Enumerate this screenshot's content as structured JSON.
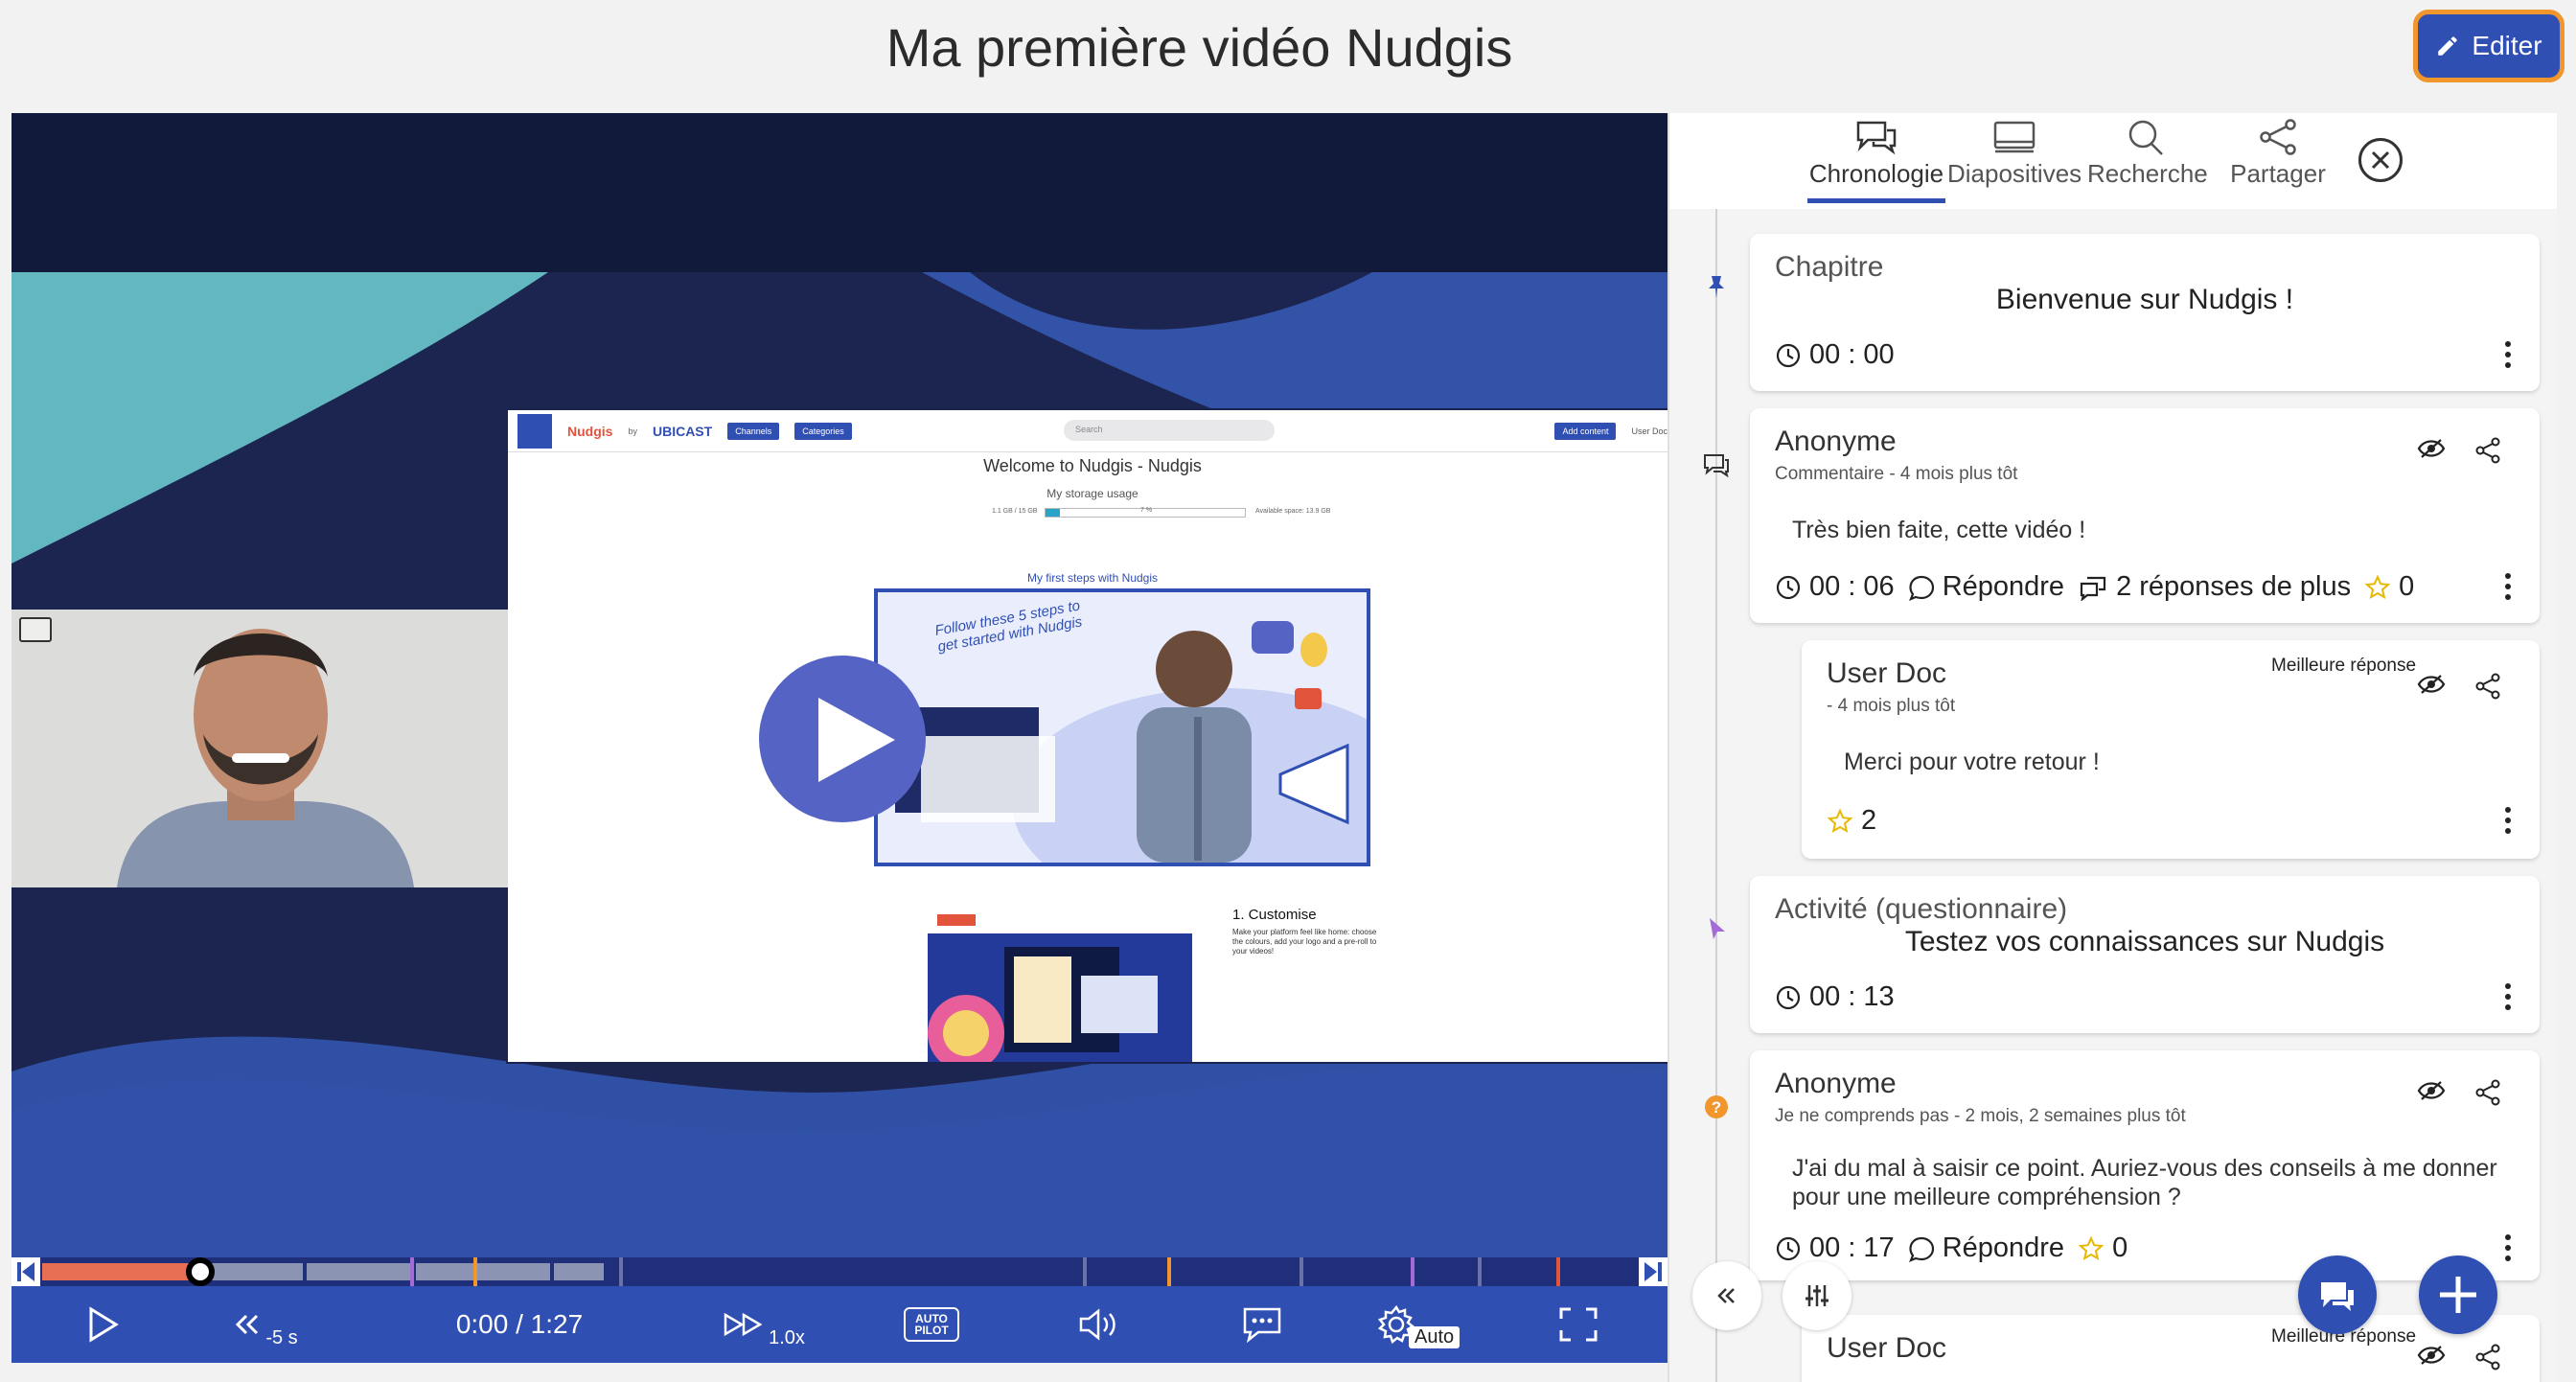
{
  "page": {
    "title": "Ma première vidéo Nudgis",
    "edit_label": "Editer"
  },
  "slide": {
    "brand": "Nudgis",
    "brand_by": "by",
    "brand2": "UBICAST",
    "menu_channels": "Channels",
    "menu_categories": "Categories",
    "search_placeholder": "Search",
    "add_content": "Add content",
    "user": "User Doc",
    "welcome": "Welcome to Nudgis - Nudgis",
    "storage_title": "My storage usage",
    "storage_used": "1.1 GB / 15 GB",
    "storage_percent": "7 %",
    "storage_available": "Available space: 13.9 GB",
    "first_steps": "My first steps with Nudgis",
    "handwritten": "Follow these 5 steps to get started with Nudgis",
    "customise_title": "1. Customise",
    "customise_text": "Make your platform feel like home: choose the colours, add your logo and a pre-roll to your videos!"
  },
  "player": {
    "timecode": "0:00 / 1:27",
    "rewind_label": "-5 s",
    "speed_label": "1.0x",
    "autopilot_label": "AUTO PILOT",
    "quality_label": "Auto",
    "progress": 0.112
  },
  "panel": {
    "tabs": [
      {
        "label": "Chronologie",
        "icon": "comments-icon"
      },
      {
        "label": "Diapositives",
        "icon": "slides-icon"
      },
      {
        "label": "Recherche",
        "icon": "search-icon"
      },
      {
        "label": "Partager",
        "icon": "share-icon"
      }
    ],
    "cards": [
      {
        "type": "Chapitre",
        "title": "Bienvenue sur Nudgis !",
        "time": "00 : 00"
      },
      {
        "author": "Anonyme",
        "meta": "Commentaire - 4 mois plus tôt",
        "body": "Très bien faite, cette vidéo !",
        "time": "00 : 06",
        "reply": "Répondre",
        "more_replies": "2 réponses de plus",
        "votes": "0"
      },
      {
        "author": "User Doc",
        "meta": "- 4 mois plus tôt",
        "best": "Meilleure réponse",
        "body": "Merci pour votre retour !",
        "votes": "2"
      },
      {
        "type": "Activité (questionnaire)",
        "title": "Testez vos connaissances sur Nudgis",
        "time": "00 : 13"
      },
      {
        "author": "Anonyme",
        "meta": "Je ne comprends pas - 2 mois, 2 semaines plus tôt",
        "body": "J'ai du mal à saisir ce point. Auriez-vous des conseils à me donner pour une meilleure compréhension ?",
        "time": "00 : 17",
        "reply": "Répondre",
        "votes": "0"
      },
      {
        "author": "User Doc",
        "best": "Meilleure réponse"
      }
    ]
  },
  "colors": {
    "accent": "#2f4fb3",
    "highlight": "#f0962d",
    "progress": "#e96f54",
    "navy": "#121a3c",
    "teal": "#63b7c0"
  }
}
